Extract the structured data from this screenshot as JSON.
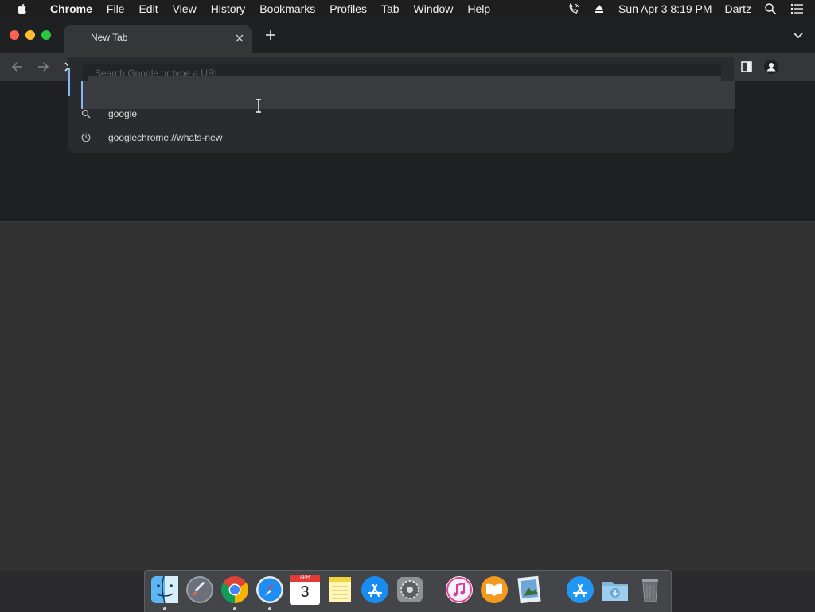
{
  "menubar": {
    "app_name": "Chrome",
    "items": [
      "File",
      "Edit",
      "View",
      "History",
      "Bookmarks",
      "Profiles",
      "Tab",
      "Window",
      "Help"
    ],
    "clock": "Sun Apr 3  8:19 PM",
    "user": "Dartz",
    "icons": [
      "apple-icon",
      "phone-icon",
      "eject-icon",
      "spotlight-search-icon",
      "control-center-list-icon"
    ]
  },
  "browser": {
    "tab_title": "New Tab",
    "omnibox_placeholder": "Search Google or type a URL",
    "suggestions": [
      {
        "text": "google",
        "icon": "search-icon"
      },
      {
        "text": "googlechrome://whats-new",
        "icon": "history-clock-icon"
      }
    ],
    "accent_color": "#8ab4f8"
  },
  "dock": {
    "apps": [
      {
        "name": "Finder",
        "running": true
      },
      {
        "name": "Launchpad",
        "running": false
      },
      {
        "name": "Google Chrome",
        "running": true
      },
      {
        "name": "Safari",
        "running": true
      },
      {
        "name": "Calendar",
        "running": false,
        "month": "APR",
        "day": "3"
      },
      {
        "name": "Notes",
        "running": false
      },
      {
        "name": "App Store",
        "running": false
      },
      {
        "name": "System Preferences",
        "running": false
      },
      {
        "name": "iTunes",
        "running": false
      },
      {
        "name": "iBooks",
        "running": false
      },
      {
        "name": "Preview",
        "running": false
      },
      {
        "name": "App Store Folder",
        "running": false
      },
      {
        "name": "Downloads",
        "running": false
      },
      {
        "name": "Trash",
        "running": false
      }
    ]
  }
}
